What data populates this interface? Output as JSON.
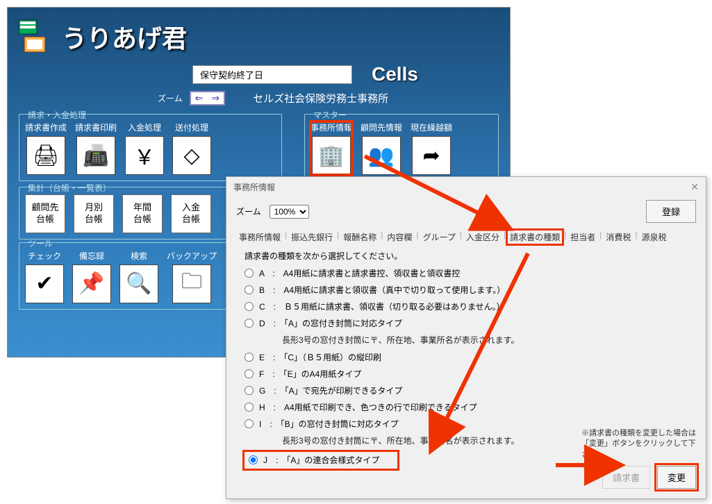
{
  "app": {
    "name": "うりあげ君",
    "maintenance_label": "保守契約終了日",
    "brand": "Cells",
    "zoom_label": "ズーム",
    "office_name": "セルズ社会保険労務士事務所"
  },
  "groups": {
    "billing": {
      "title": "請求・入金処理",
      "items": [
        {
          "label": "請求書作成",
          "glyph": "🖨"
        },
        {
          "label": "請求書印刷",
          "glyph": "📠"
        },
        {
          "label": "入金処理",
          "glyph": "￥"
        },
        {
          "label": "送付処理",
          "glyph": "◇"
        }
      ]
    },
    "master": {
      "title": "マスター",
      "items": [
        {
          "label": "事務所情報",
          "glyph": "🏢"
        },
        {
          "label": "顧問先情報",
          "glyph": "👥"
        },
        {
          "label": "現在繰越額",
          "glyph": "➦"
        }
      ]
    },
    "summary": {
      "title": "集計（台帳・一覧表）",
      "items": [
        "顧問先\n台帳",
        "月別\n台帳",
        "年間\n台帳",
        "入金\n台帳"
      ]
    },
    "tool": {
      "title": "ツール",
      "items": [
        {
          "label": "チェック",
          "glyph": "✔"
        },
        {
          "label": "備忘録",
          "glyph": "📌"
        },
        {
          "label": "検索",
          "glyph": "🔍"
        },
        {
          "label": "バックアップ",
          "glyph": "🗀"
        }
      ]
    }
  },
  "dialog": {
    "title": "事務所情報",
    "zoom_label": "ズーム",
    "zoom_value": "100%",
    "register_label": "登録",
    "tabs": [
      "事務所情報",
      "振込先銀行",
      "報酬名称",
      "内容欄",
      "グループ",
      "入金区分",
      "請求書の種類",
      "担当者",
      "消費税",
      "源泉税"
    ],
    "active_tab_index": 6,
    "instruction": "請求書の種類を次から選択してください。",
    "options": [
      {
        "key": "A",
        "text": "A4用紙に請求書と請求書控、領収書と領収書控"
      },
      {
        "key": "B",
        "text": "A4用紙に請求書と領収書（真中で切り取って使用します。）"
      },
      {
        "key": "C",
        "text": "Ｂ５用紙に請求書、領収書（切り取る必要はありません。）"
      },
      {
        "key": "D",
        "text": "「A」の窓付き封筒に対応タイプ",
        "sub": "長形3号の窓付き封筒に〒、所在地、事業所名が表示されます。"
      },
      {
        "key": "E",
        "text": "「C」（Ｂ５用紙）の縦印刷"
      },
      {
        "key": "F",
        "text": "「E」のA4用紙タイプ"
      },
      {
        "key": "G",
        "text": "「A」で宛先が印刷できるタイプ"
      },
      {
        "key": "H",
        "text": "A4用紙で印刷でき、色つきの行で印刷できるタイプ"
      },
      {
        "key": "I",
        "text": "「B」の窓付き封筒に対応タイプ",
        "sub": "長形3号の窓付き封筒に〒、所在地、事業所名が表示されます。"
      },
      {
        "key": "J",
        "text": "「A」の連合会様式タイプ",
        "selected": true
      }
    ],
    "footer_note": "※請求書の種類を変更した場合は「変更」ボタンをクリックして下さい。",
    "preview_label": "請求書",
    "change_label": "変更"
  }
}
